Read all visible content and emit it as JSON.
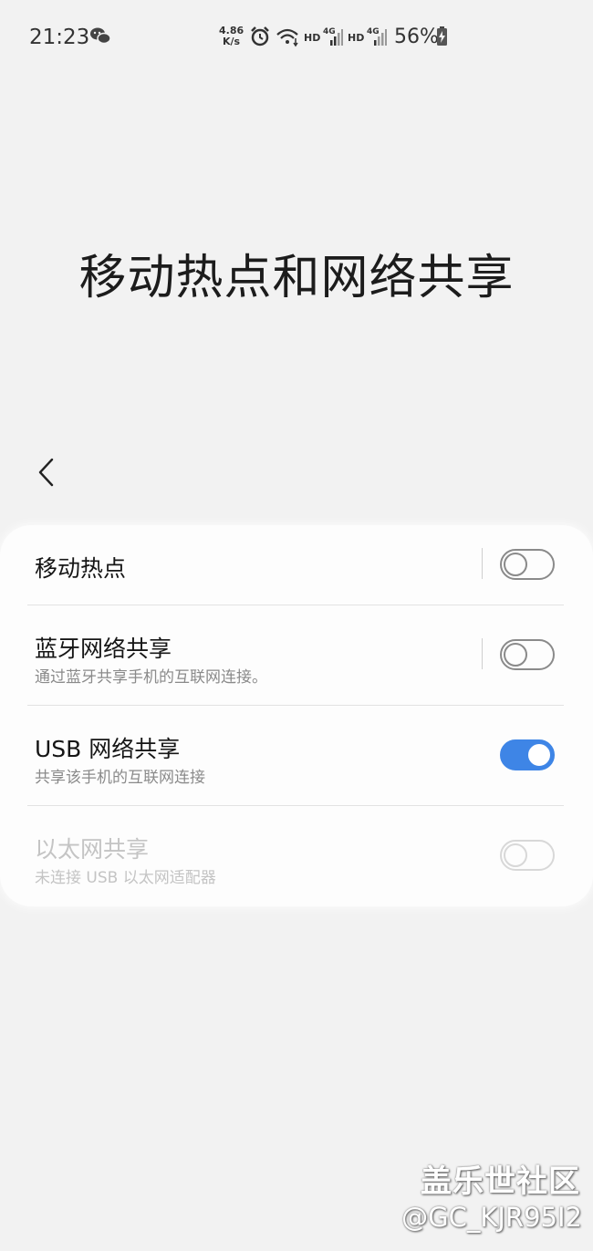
{
  "status_bar": {
    "time": "21:23",
    "net_speed_value": "4.86",
    "net_speed_unit": "K/s",
    "hd1": "HD",
    "net1": "4G",
    "hd2": "HD",
    "net2": "4G",
    "battery": "56%"
  },
  "page": {
    "title": "移动热点和网络共享"
  },
  "settings": {
    "items": [
      {
        "title": "移动热点",
        "subtitle": "",
        "state": "off"
      },
      {
        "title": "蓝牙网络共享",
        "subtitle": "通过蓝牙共享手机的互联网连接。",
        "state": "off"
      },
      {
        "title": "USB 网络共享",
        "subtitle": "共享该手机的互联网连接",
        "state": "on"
      },
      {
        "title": "以太网共享",
        "subtitle": "未连接 USB 以太网适配器",
        "state": "disabled"
      }
    ]
  },
  "colors": {
    "accent": "#3e85e6",
    "background": "#f2f2f2",
    "card": "#fdfdfd"
  },
  "watermark": {
    "logo": "盖乐世社区",
    "handle": "@GC_KJR95I2"
  }
}
